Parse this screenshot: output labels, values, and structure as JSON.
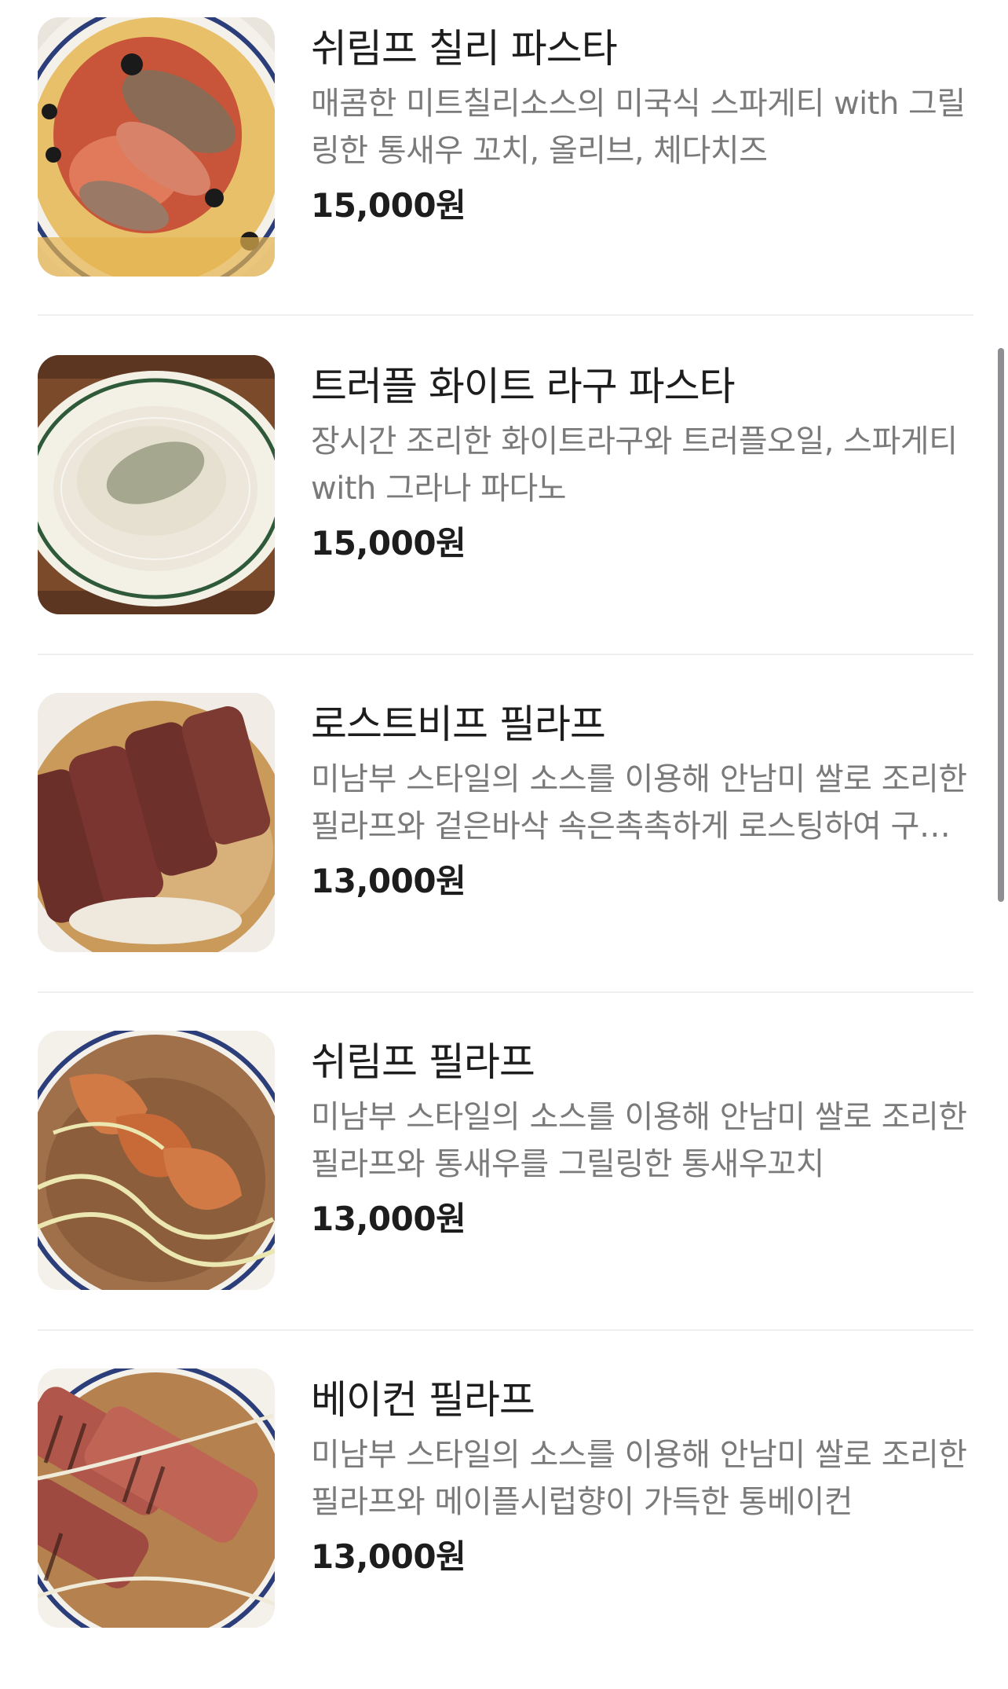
{
  "menu": {
    "items": [
      {
        "name": "쉬림프 칠리 파스타",
        "description": "매콤한 미트칠리소스의 미국식 스파게티 with 그릴링한 통새우 꼬치, 올리브, 체다치즈",
        "price": "15,000원",
        "image_icon": "shrimp-chili-pasta-photo"
      },
      {
        "name": "트러플 화이트 라구 파스타",
        "description": "장시간 조리한 화이트라구와 트러플오일, 스파게티 with 그라나 파다노",
        "price": "15,000원",
        "image_icon": "truffle-white-ragu-pasta-photo"
      },
      {
        "name": "로스트비프 필라프",
        "description": "미남부 스타일의 소스를 이용해 안남미 쌀로 조리한 필라프와 겉은바삭 속은촉촉하게 로스팅하여 구운 로스트비프",
        "price": "13,000원",
        "image_icon": "roast-beef-pilaf-photo"
      },
      {
        "name": "쉬림프 필라프",
        "description": "미남부 스타일의 소스를 이용해 안남미 쌀로 조리한 필라프와 통새우를 그릴링한 통새우꼬치",
        "price": "13,000원",
        "image_icon": "shrimp-pilaf-photo"
      },
      {
        "name": "베이컨 필라프",
        "description": "미남부 스타일의 소스를 이용해 안남미 쌀로 조리한 필라프와 메이플시럽향이 가득한 통베이컨",
        "price": "13,000원",
        "image_icon": "bacon-pilaf-photo"
      }
    ]
  },
  "colors": {
    "title": "#1d1d1d",
    "description": "#7a7a7a",
    "divider": "#efefef",
    "scrollbar": "#8e8e93"
  }
}
